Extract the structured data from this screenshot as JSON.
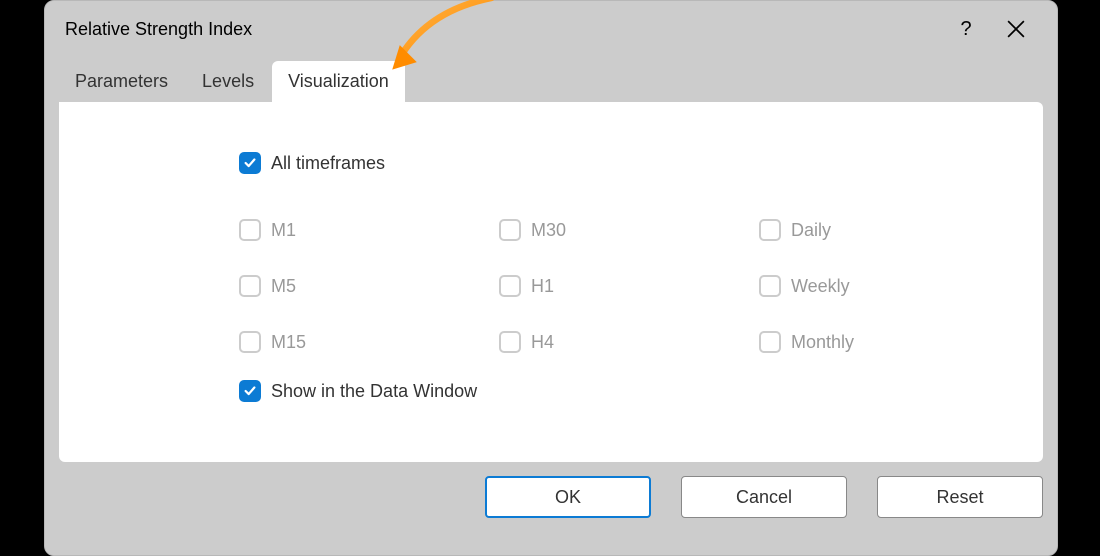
{
  "dialog": {
    "title": "Relative Strength Index"
  },
  "tabs": {
    "parameters": "Parameters",
    "levels": "Levels",
    "visualization": "Visualization"
  },
  "checkboxes": {
    "all_timeframes": "All timeframes",
    "show_data_window": "Show in the Data Window"
  },
  "timeframes": {
    "m1": "M1",
    "m5": "M5",
    "m15": "M15",
    "m30": "M30",
    "h1": "H1",
    "h4": "H4",
    "daily": "Daily",
    "weekly": "Weekly",
    "monthly": "Monthly"
  },
  "buttons": {
    "ok": "OK",
    "cancel": "Cancel",
    "reset": "Reset"
  }
}
